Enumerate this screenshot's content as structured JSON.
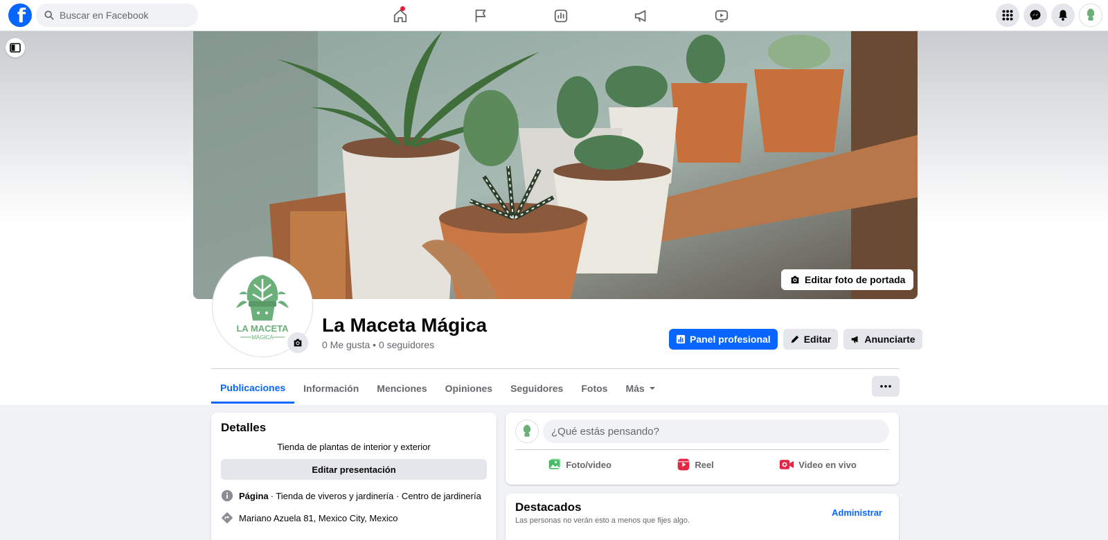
{
  "topbar": {
    "search_placeholder": "Buscar en Facebook",
    "nav": [
      "home-icon",
      "flag-icon",
      "insights-icon",
      "megaphone-icon",
      "video-icon"
    ]
  },
  "colors": {
    "brand": "#0866ff",
    "notification": "#e41e3f",
    "plant_green": "#6bb07a"
  },
  "cover": {
    "edit_label": "Editar foto de portada"
  },
  "profile": {
    "logo_text_1": "LA MACETA",
    "logo_text_2": "MÁGICA",
    "name": "La Maceta Mágica",
    "stats": "0 Me gusta • 0 seguidores"
  },
  "actions": {
    "panel": "Panel profesional",
    "edit": "Editar",
    "advertise": "Anunciarte"
  },
  "tabs": [
    {
      "label": "Publicaciones",
      "active": true
    },
    {
      "label": "Información"
    },
    {
      "label": "Menciones"
    },
    {
      "label": "Opiniones"
    },
    {
      "label": "Seguidores"
    },
    {
      "label": "Fotos"
    },
    {
      "label": "Más"
    }
  ],
  "details": {
    "title": "Detalles",
    "bio": "Tienda de plantas de interior y exterior",
    "edit_presentation": "Editar presentación",
    "page_label": "Página",
    "page_categories": "· Tienda de viveros y jardinería · Centro de jardinería",
    "address": "Mariano Azuela 81, Mexico City, Mexico"
  },
  "composer": {
    "placeholder": "¿Qué estás pensando?",
    "photo": "Foto/video",
    "reel": "Reel",
    "live": "Video en vivo"
  },
  "featured": {
    "title": "Destacados",
    "subtitle": "Las personas no verán esto a menos que fijes algo.",
    "manage": "Administrar"
  }
}
